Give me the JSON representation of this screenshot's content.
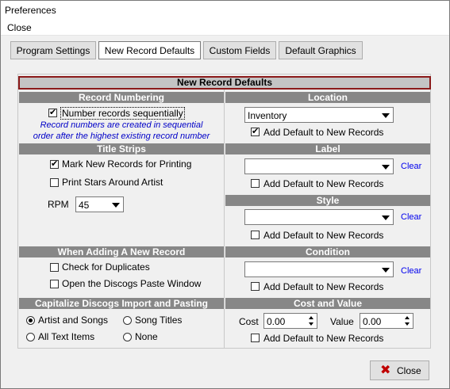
{
  "window": {
    "title": "Preferences"
  },
  "menu": {
    "close": "Close"
  },
  "tabs": [
    "Program Settings",
    "New Record Defaults",
    "Custom Fields",
    "Default Graphics"
  ],
  "main_header": "New Record Defaults",
  "record_numbering": {
    "header": "Record Numbering",
    "checkbox_label": "Number records sequentially",
    "checked": true,
    "note_line1": "Record numbers are created in sequential",
    "note_line2": "order after the highest existing record number"
  },
  "location": {
    "header": "Location",
    "value": "Inventory",
    "add_default_label": "Add Default to New Records",
    "add_default_checked": true
  },
  "title_strips": {
    "header": "Title Strips",
    "mark_label": "Mark New Records for Printing",
    "mark_checked": true,
    "stars_label": "Print Stars Around Artist",
    "stars_checked": false,
    "rpm_label": "RPM",
    "rpm_value": "45"
  },
  "label": {
    "header": "Label",
    "value": "",
    "clear": "Clear",
    "add_default_label": "Add Default to New Records",
    "add_default_checked": false
  },
  "style": {
    "header": "Style",
    "value": "",
    "clear": "Clear",
    "add_default_label": "Add Default to New Records",
    "add_default_checked": false
  },
  "adding": {
    "header": "When Adding A New Record",
    "duplicates_label": "Check for Duplicates",
    "duplicates_checked": false,
    "discogs_label": "Open the Discogs Paste Window",
    "discogs_checked": false
  },
  "condition": {
    "header": "Condition",
    "value": "",
    "clear": "Clear",
    "add_default_label": "Add Default to New Records",
    "add_default_checked": false
  },
  "capitalize": {
    "header": "Capitalize Discogs Import and Pasting",
    "options": [
      "Artist and Songs",
      "Song Titles",
      "All Text Items",
      "None"
    ],
    "selected": "Artist and Songs"
  },
  "cost_value": {
    "header": "Cost and Value",
    "cost_label": "Cost",
    "cost_value": "0.00",
    "value_label": "Value",
    "value_value": "0.00",
    "add_default_label": "Add Default to New Records",
    "add_default_checked": false
  },
  "buttons": {
    "close": "Close"
  }
}
